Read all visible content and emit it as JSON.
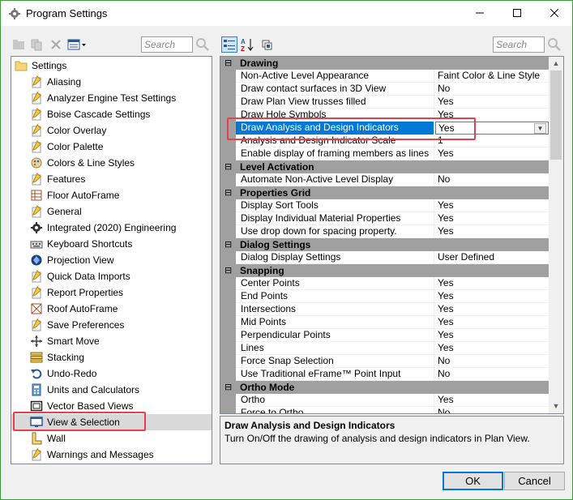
{
  "window": {
    "title": "Program Settings",
    "icon": "gear-icon"
  },
  "left_toolbar": {
    "search_placeholder": "Search"
  },
  "right_toolbar": {
    "search_placeholder": "Search"
  },
  "tree": {
    "root": {
      "label": "Settings",
      "icon": "folder-icon"
    },
    "items": [
      {
        "label": "Aliasing",
        "icon": "pencil-page-icon"
      },
      {
        "label": "Analyzer Engine Test Settings",
        "icon": "pencil-page-icon"
      },
      {
        "label": "Boise Cascade Settings",
        "icon": "pencil-page-icon"
      },
      {
        "label": "Color Overlay",
        "icon": "pencil-page-icon"
      },
      {
        "label": "Color Palette",
        "icon": "pencil-page-icon"
      },
      {
        "label": "Colors & Line Styles",
        "icon": "palette-icon"
      },
      {
        "label": "Features",
        "icon": "pencil-page-icon"
      },
      {
        "label": "Floor AutoFrame",
        "icon": "floor-frame-icon"
      },
      {
        "label": "General",
        "icon": "pencil-page-icon"
      },
      {
        "label": "Integrated (2020) Engineering",
        "icon": "gear-icon"
      },
      {
        "label": "Keyboard Shortcuts",
        "icon": "keyboard-icon"
      },
      {
        "label": "Projection View",
        "icon": "projection-icon"
      },
      {
        "label": "Quick Data Imports",
        "icon": "pencil-page-icon"
      },
      {
        "label": "Report Properties",
        "icon": "pencil-page-icon"
      },
      {
        "label": "Roof AutoFrame",
        "icon": "roof-frame-icon"
      },
      {
        "label": "Save Preferences",
        "icon": "pencil-page-icon"
      },
      {
        "label": "Smart Move",
        "icon": "move-icon"
      },
      {
        "label": "Stacking",
        "icon": "stacking-icon"
      },
      {
        "label": "Undo-Redo",
        "icon": "undo-icon"
      },
      {
        "label": "Units and Calculators",
        "icon": "calculator-icon"
      },
      {
        "label": "Vector Based Views",
        "icon": "vector-view-icon"
      },
      {
        "label": "View & Selection",
        "icon": "monitor-icon",
        "selected": true
      },
      {
        "label": "Wall",
        "icon": "wall-icon"
      },
      {
        "label": "Warnings and Messages",
        "icon": "pencil-page-icon"
      }
    ]
  },
  "grid": {
    "categories": [
      {
        "name": "Drawing",
        "rows": [
          {
            "name": "Non-Active Level Appearance",
            "value": "Faint Color & Line Style"
          },
          {
            "name": "Draw contact surfaces in 3D View",
            "value": "No"
          },
          {
            "name": "Draw Plan View trusses filled",
            "value": "Yes"
          },
          {
            "name": "Draw Hole Symbols",
            "value": "Yes"
          },
          {
            "name": "Draw Analysis and Design Indicators",
            "value": "Yes",
            "selected": true
          },
          {
            "name": "Analysis and Design Indicator Scale",
            "value": "1"
          },
          {
            "name": "Enable display of framing members as lines",
            "value": "Yes"
          }
        ]
      },
      {
        "name": "Level Activation",
        "rows": [
          {
            "name": "Automate Non-Active Level Display",
            "value": "No"
          }
        ]
      },
      {
        "name": "Properties Grid",
        "rows": [
          {
            "name": "Display Sort Tools",
            "value": "Yes"
          },
          {
            "name": "Display Individual Material Properties",
            "value": "Yes"
          },
          {
            "name": "Use drop down for spacing property.",
            "value": "Yes"
          }
        ]
      },
      {
        "name": "Dialog Settings",
        "rows": [
          {
            "name": "Dialog Display Settings",
            "value": "User Defined"
          }
        ]
      },
      {
        "name": "Snapping",
        "rows": [
          {
            "name": "Center Points",
            "value": "Yes"
          },
          {
            "name": "End Points",
            "value": "Yes"
          },
          {
            "name": "Intersections",
            "value": "Yes"
          },
          {
            "name": "Mid Points",
            "value": "Yes"
          },
          {
            "name": "Perpendicular Points",
            "value": "Yes"
          },
          {
            "name": "Lines",
            "value": "Yes"
          },
          {
            "name": "Force Snap Selection",
            "value": "No"
          },
          {
            "name": "Use Traditional eFrame™ Point Input",
            "value": "No"
          }
        ]
      },
      {
        "name": "Ortho Mode",
        "rows": [
          {
            "name": "Ortho",
            "value": "Yes"
          },
          {
            "name": "Force to Ortho",
            "value": "No"
          }
        ]
      }
    ]
  },
  "description": {
    "title": "Draw Analysis and Design Indicators",
    "text": "Turn On/Off the drawing of analysis and design indicators in Plan View."
  },
  "buttons": {
    "ok": "OK",
    "cancel": "Cancel"
  },
  "colors": {
    "selection": "#0078d7",
    "highlight": "#e8404a",
    "category_bg": "#a0a0a0"
  }
}
